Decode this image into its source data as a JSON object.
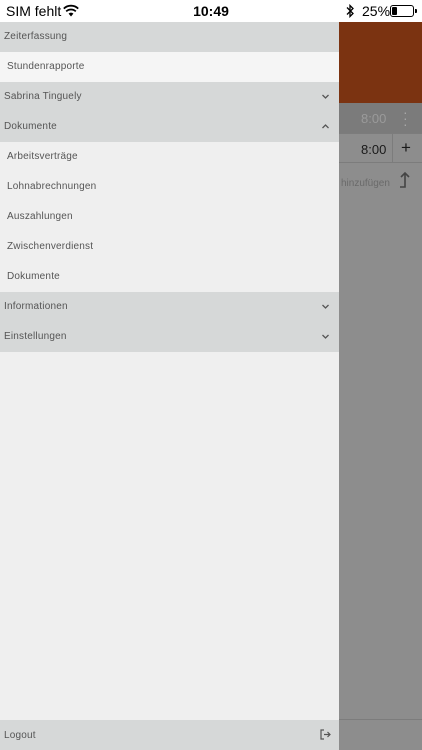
{
  "status_bar": {
    "carrier": "SIM fehlt",
    "time": "10:49",
    "battery_percent": "25%",
    "battery_level": 0.25
  },
  "background_app": {
    "row1_value": "8:00",
    "row2_value": "8:00",
    "plus": "+",
    "add_text": "hinzufügen",
    "header_color": "#7b3311"
  },
  "drawer": {
    "items": [
      {
        "label": "Zeiterfassung",
        "type": "section"
      },
      {
        "label": "Stundenrapporte",
        "type": "item"
      },
      {
        "label": "Sabrina Tinguely",
        "type": "section",
        "chevron": "chevron-down-icon"
      },
      {
        "label": "Dokumente",
        "type": "section",
        "chevron": "chevron-up-icon"
      },
      {
        "label": "Arbeitsverträge",
        "type": "item"
      },
      {
        "label": "Lohnabrechnungen",
        "type": "item"
      },
      {
        "label": "Auszahlungen",
        "type": "item"
      },
      {
        "label": "Zwischenverdienst",
        "type": "item"
      },
      {
        "label": "Dokumente",
        "type": "item"
      },
      {
        "label": "Informationen",
        "type": "section",
        "chevron": "chevron-down-icon"
      },
      {
        "label": "Einstellungen",
        "type": "section",
        "chevron": "chevron-down-icon"
      }
    ],
    "logout_label": "Logout"
  }
}
